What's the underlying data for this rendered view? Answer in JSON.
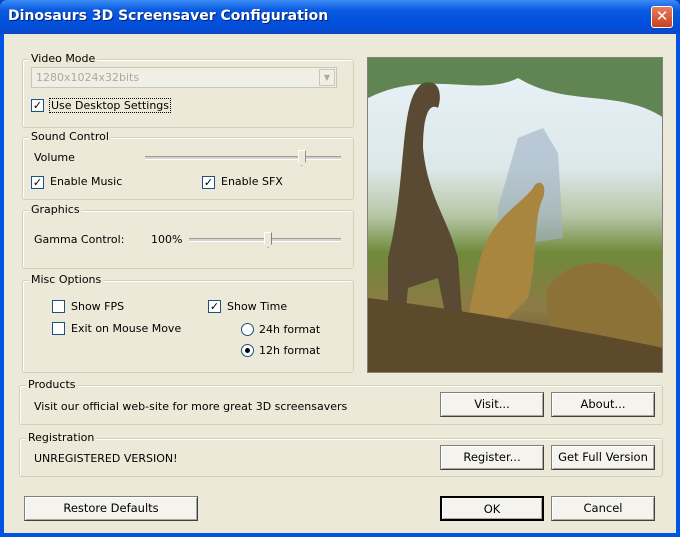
{
  "window": {
    "title": "Dinosaurs 3D Screensaver Configuration",
    "close_icon": "close-icon"
  },
  "video_mode": {
    "label": "Video Mode",
    "resolution": "1280x1024x32bits",
    "use_desktop_label": "Use Desktop Settings",
    "use_desktop_checked": true
  },
  "sound": {
    "label": "Sound Control",
    "volume_label": "Volume",
    "volume_value": 0.8,
    "music_label": "Enable Music",
    "music_checked": true,
    "sfx_label": "Enable SFX",
    "sfx_checked": true
  },
  "graphics": {
    "label": "Graphics",
    "gamma_label": "Gamma Control:",
    "gamma_value_text": "100%",
    "gamma_value": 0.52
  },
  "misc": {
    "label": "Misc Options",
    "show_fps": "Show FPS",
    "exit_mouse": "Exit on Mouse Move",
    "show_time": "Show Time",
    "format_24": "24h format",
    "format_12": "12h format",
    "selected_format": "12h"
  },
  "products": {
    "label": "Products",
    "text": "Visit our official web-site for more great 3D screensavers",
    "visit": "Visit...",
    "about": "About..."
  },
  "registration": {
    "label": "Registration",
    "status": "UNREGISTERED VERSION!",
    "register": "Register...",
    "full": "Get Full Version"
  },
  "footer": {
    "restore": "Restore Defaults",
    "ok": "OK",
    "cancel": "Cancel"
  },
  "colors": {
    "title_bar": "#0054e3",
    "face": "#ece9d8"
  }
}
